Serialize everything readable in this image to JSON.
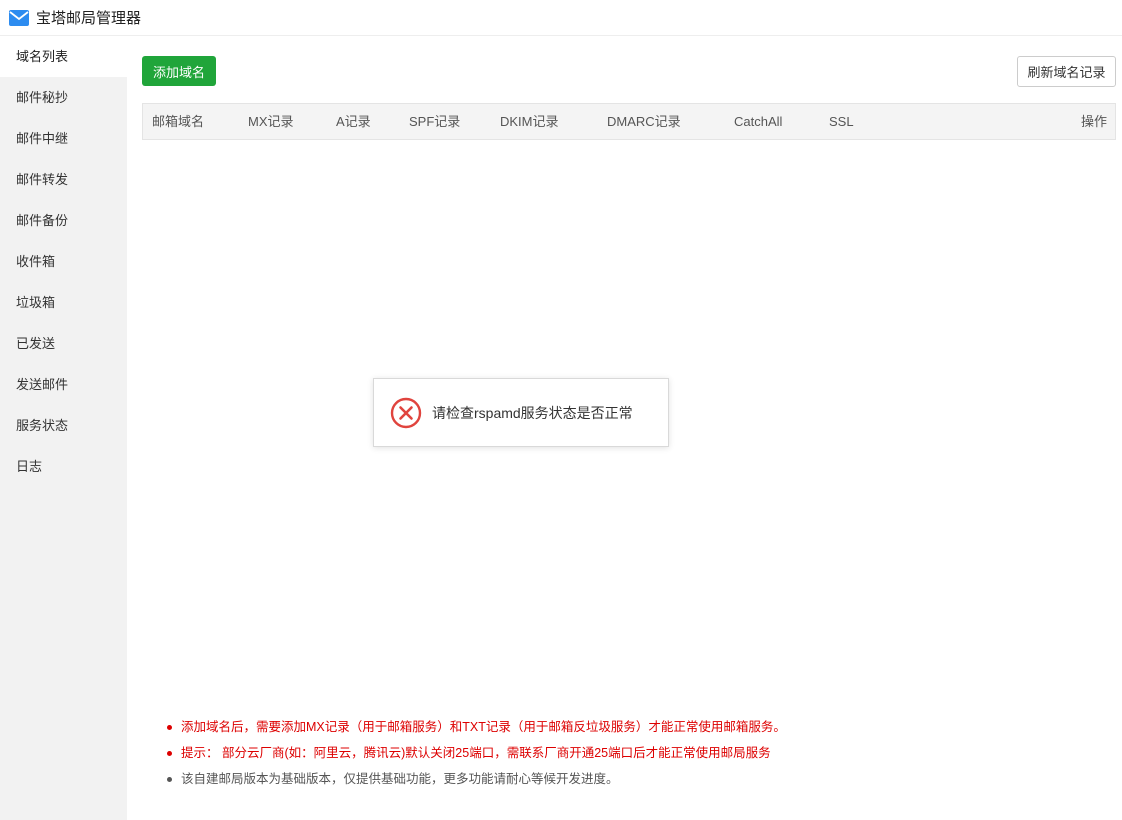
{
  "app": {
    "title": "宝塔邮局管理器",
    "accent": "#20a53a"
  },
  "sidebar": {
    "items": [
      {
        "label": "域名列表",
        "active": true
      },
      {
        "label": "邮件秘抄"
      },
      {
        "label": "邮件中继"
      },
      {
        "label": "邮件转发"
      },
      {
        "label": "邮件备份"
      },
      {
        "label": "收件箱"
      },
      {
        "label": "垃圾箱"
      },
      {
        "label": "已发送"
      },
      {
        "label": "发送邮件"
      },
      {
        "label": "服务状态"
      },
      {
        "label": "日志"
      }
    ]
  },
  "toolbar": {
    "add_label": "添加域名",
    "refresh_label": "刷新域名记录"
  },
  "table": {
    "columns": [
      "邮箱域名",
      "MX记录",
      "A记录",
      "SPF记录",
      "DKIM记录",
      "DMARC记录",
      "CatchAll",
      "SSL",
      "操作"
    ]
  },
  "notes": [
    {
      "text": "添加域名后，需要添加MX记录（用于邮箱服务）和TXT记录（用于邮箱反垃圾服务）才能正常使用邮箱服务。",
      "level": "warn"
    },
    {
      "text": "提示： 部分云厂商(如：阿里云，腾讯云)默认关闭25端口，需联系厂商开通25端口后才能正常使用邮局服务",
      "level": "warn"
    },
    {
      "text": "该自建邮局版本为基础版本，仅提供基础功能，更多功能请耐心等候开发进度。",
      "level": "info"
    }
  ],
  "toast": {
    "message": "请检查rspamd服务状态是否正常",
    "icon": "error-circle-icon",
    "color": "#e0443e"
  }
}
